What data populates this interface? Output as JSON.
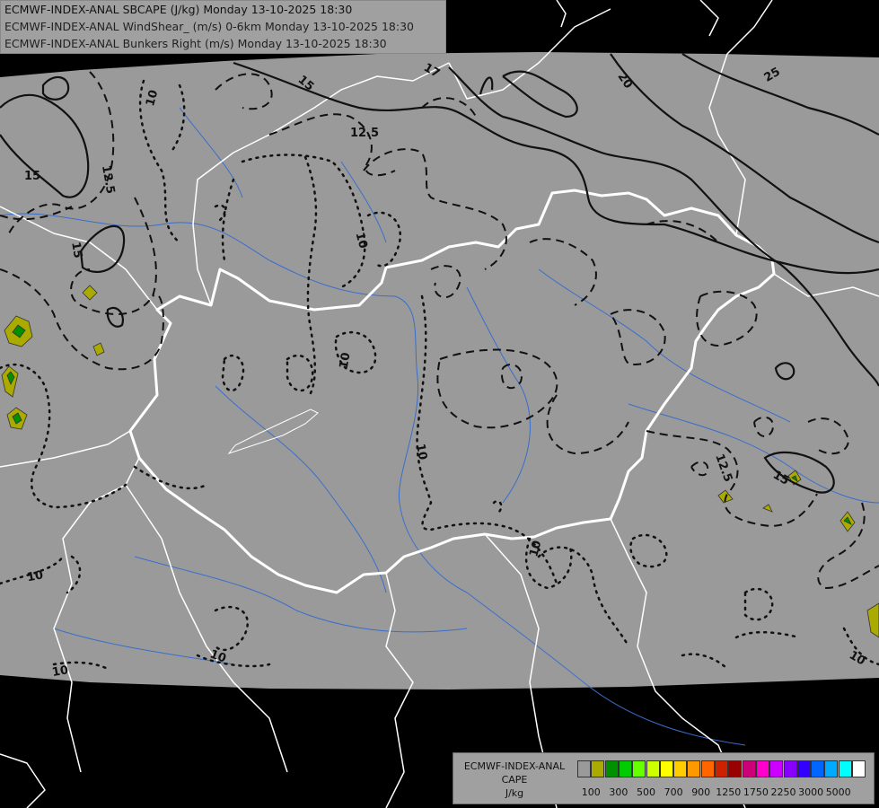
{
  "header": {
    "line1": "ECMWF-INDEX-ANAL SBCAPE (J/kg) Monday 13-10-2025 18:30",
    "line2": "ECMWF-INDEX-ANAL WindShear_ (m/s) 0-6km Monday 13-10-2025 18:30",
    "line3": "ECMWF-INDEX-ANAL Bunkers Right (m/s) Monday 13-10-2025 18:30"
  },
  "contour_labels": {
    "l1": "10",
    "l2": "12.5",
    "l3": "15",
    "l4": "15",
    "l5": "15",
    "l6": "17",
    "l7": "20",
    "l8": "25",
    "l9": "12.5",
    "l10": "10",
    "l11": "10",
    "l12": "10",
    "l13": "10",
    "l14": "12.5",
    "l15": "15",
    "l16": "10",
    "l17": "10",
    "l18": "10",
    "l19": "10"
  },
  "legend": {
    "title1": "ECMWF-INDEX-ANAL",
    "title2": "CAPE",
    "title3": "J/kg",
    "swatches": [
      "#9a9a9a",
      "#aaaa00",
      "#009000",
      "#00cc00",
      "#66ff00",
      "#ccff00",
      "#ffff00",
      "#ffcc00",
      "#ff9900",
      "#ff6600",
      "#cc2200",
      "#990000",
      "#cc0077",
      "#ff00cc",
      "#cc00ff",
      "#8800ff",
      "#3300ff",
      "#0066ff",
      "#00aaff",
      "#00ffff",
      "#ffffff"
    ],
    "ticks": [
      "100",
      "300",
      "500",
      "700",
      "900",
      "1250",
      "1750",
      "2250",
      "3000",
      "5000"
    ]
  },
  "colors": {
    "background": "#000000",
    "field": "#9a9a9a",
    "borders": "#ffffff",
    "rivers": "#3a6ecc",
    "cape_low": "#aaaa00",
    "cape_mid": "#009000"
  }
}
